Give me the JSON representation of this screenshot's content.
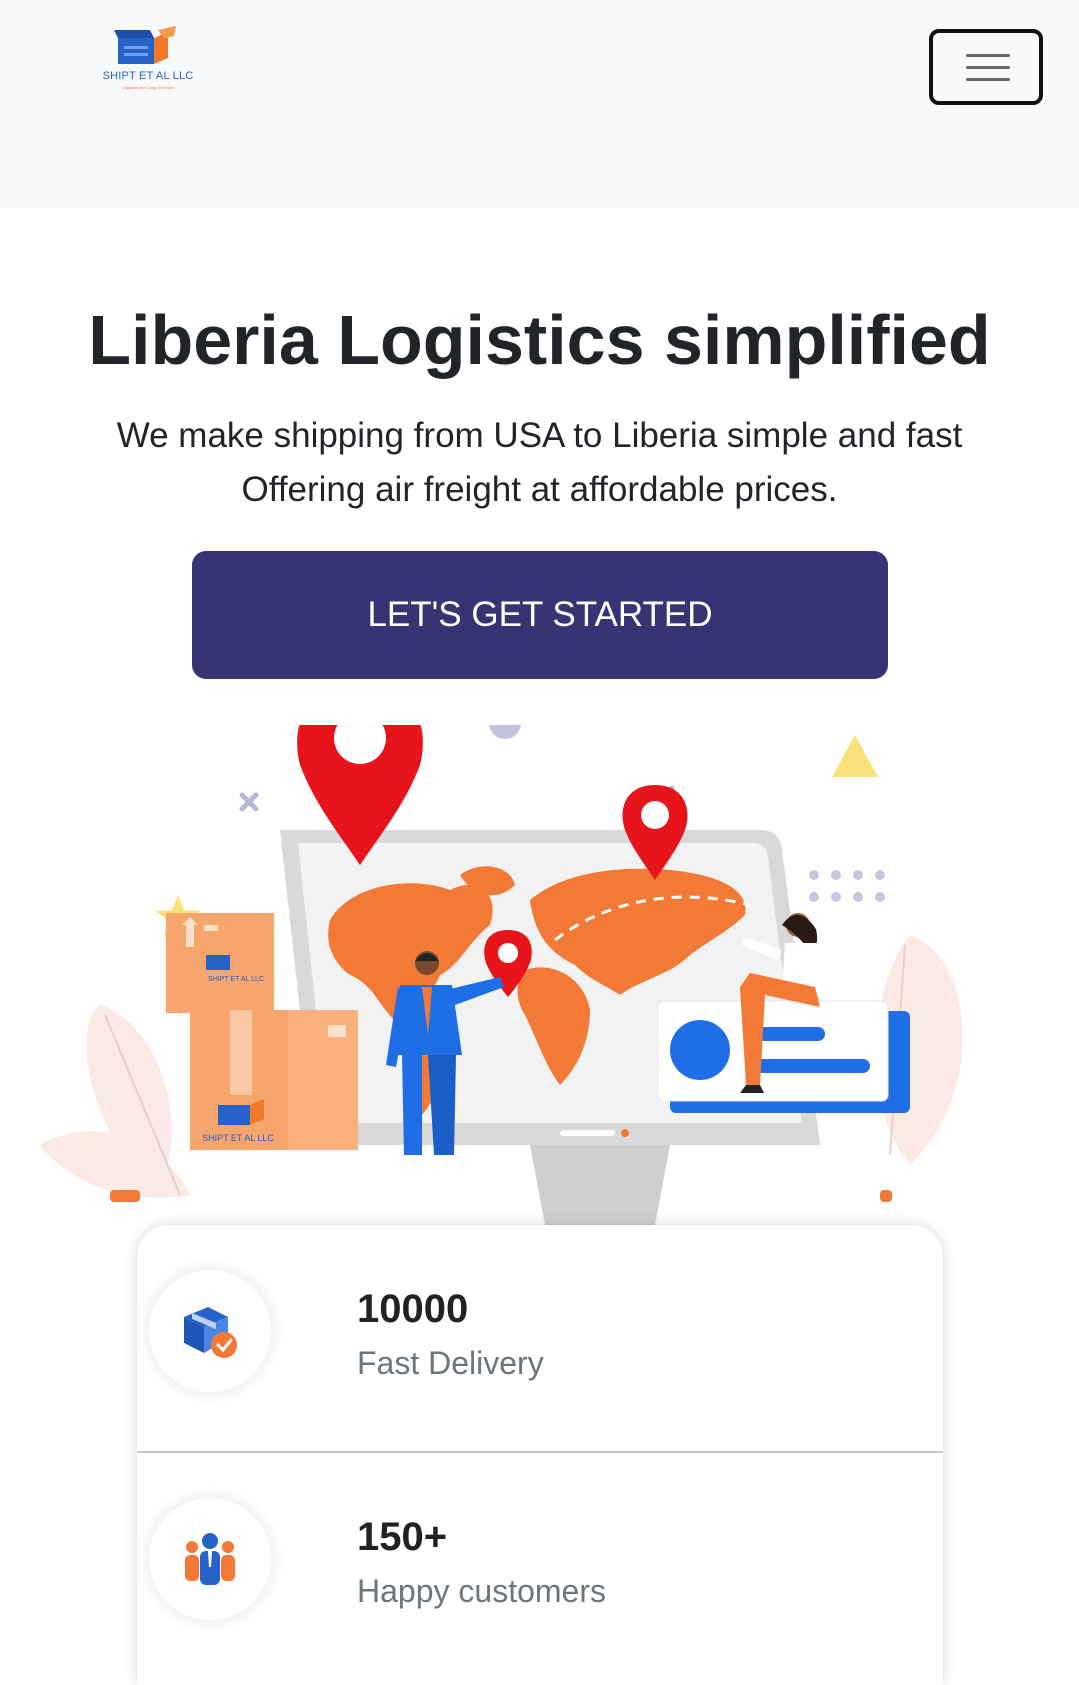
{
  "brand": {
    "name": "SHIPT ET AL LLC",
    "tagline": "Logistics and Cargo Services"
  },
  "nav": {
    "toggle_label": "Toggle navigation"
  },
  "hero": {
    "title": "Liberia Logistics simplified",
    "subtitle_line1": "We make shipping from USA to Liberia simple and fast",
    "subtitle_line2": "Offering air freight at affordable prices.",
    "cta_label": "LET'S GET STARTED"
  },
  "illustration": {
    "box_label": "SHIPT ET AL LLC"
  },
  "stats": [
    {
      "value": "10000",
      "label": "Fast Delivery",
      "icon": "delivery-box-icon"
    },
    {
      "value": "150+",
      "label": "Happy customers",
      "icon": "customers-icon"
    }
  ],
  "colors": {
    "primary": "#363473",
    "accent_orange": "#f27a36",
    "pin_red": "#e8141c",
    "brand_blue": "#2563c9"
  }
}
